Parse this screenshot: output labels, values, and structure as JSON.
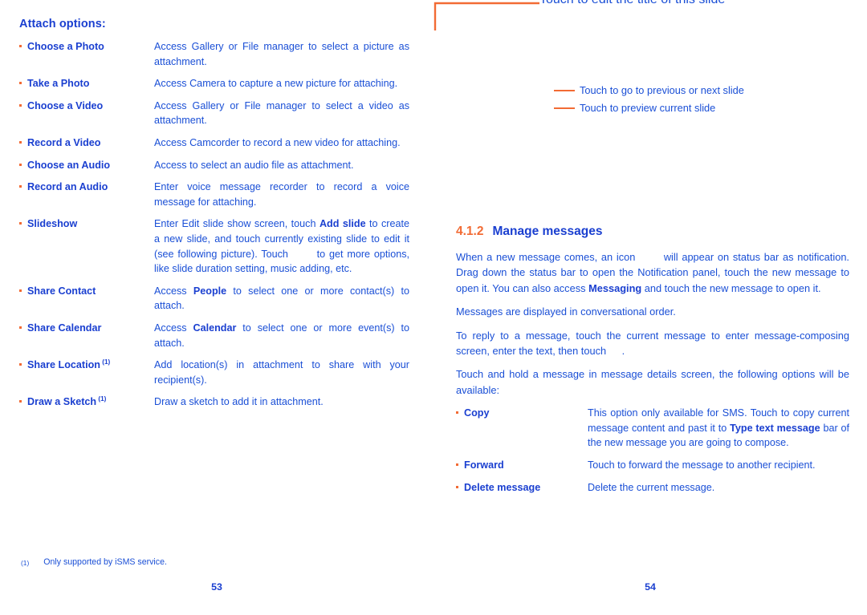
{
  "document": {
    "accent_blue": "#1a3fd0",
    "body_blue": "#1a4fd6",
    "accent_orange": "#f26b34"
  },
  "left_page": {
    "heading": "Attach options:",
    "folio": "53",
    "options": [
      {
        "term": "Choose a Photo",
        "footnote_mark": "",
        "desc_parts": [
          {
            "text": "Access Gallery or File manager to select a picture as attachment.",
            "bold": false
          }
        ]
      },
      {
        "term": "Take a Photo",
        "footnote_mark": "",
        "desc_parts": [
          {
            "text": "Access Camera to capture a new picture for attaching.",
            "bold": false
          }
        ]
      },
      {
        "term": "Choose a Video",
        "footnote_mark": "",
        "desc_parts": [
          {
            "text": "Access Gallery or File manager to select a video as attachment.",
            "bold": false
          }
        ]
      },
      {
        "term": "Record a Video",
        "footnote_mark": "",
        "desc_parts": [
          {
            "text": "Access Camcorder to record a new video for attaching.",
            "bold": false
          }
        ]
      },
      {
        "term": "Choose an Audio",
        "footnote_mark": "",
        "desc_parts": [
          {
            "text": "Access to select an audio file as attachment.",
            "bold": false
          }
        ]
      },
      {
        "term": "Record an Audio",
        "footnote_mark": "",
        "desc_parts": [
          {
            "text": "Enter voice message recorder to record a voice message for attaching.",
            "bold": false
          }
        ]
      },
      {
        "term": "Slideshow",
        "footnote_mark": "",
        "desc_parts": [
          {
            "text": "Enter Edit slide show screen, touch ",
            "bold": false
          },
          {
            "text": "Add slide",
            "bold": true
          },
          {
            "text": " to create a new slide, and touch currently existing slide to edit it (see following picture). Touch ",
            "bold": false
          },
          {
            "text": "icon-placeholder",
            "icon_gap": true
          },
          {
            "text": " to get more options, like slide duration setting, music adding, etc.",
            "bold": false
          }
        ]
      },
      {
        "term": "Share Contact",
        "footnote_mark": "",
        "desc_parts": [
          {
            "text": "Access ",
            "bold": false
          },
          {
            "text": "People",
            "bold": true
          },
          {
            "text": " to select one or more contact(s) to attach.",
            "bold": false
          }
        ]
      },
      {
        "term": "Share Calendar",
        "footnote_mark": "",
        "desc_parts": [
          {
            "text": "Access ",
            "bold": false
          },
          {
            "text": "Calendar",
            "bold": true
          },
          {
            "text": " to select one or more event(s) to attach.",
            "bold": false
          }
        ]
      },
      {
        "term": "Share Location",
        "footnote_mark": "(1)",
        "desc_parts": [
          {
            "text": "Add location(s) in attachment to share with your recipient(s).",
            "bold": false
          }
        ]
      },
      {
        "term": "Draw a Sketch",
        "footnote_mark": "(1)",
        "desc_parts": [
          {
            "text": "Draw a sketch to add it in attachment.",
            "bold": false
          }
        ]
      }
    ],
    "footnote": {
      "mark": "(1)",
      "text": "Only supported by iSMS service."
    }
  },
  "right_page": {
    "folio": "54",
    "callouts": [
      {
        "label": "Touch to go to previous or next slide",
        "leader": "dash"
      },
      {
        "label": "Touch to preview current slide",
        "leader": "dash"
      },
      {
        "label": "Touch to edit the title of this slide",
        "leader": "elbow"
      }
    ],
    "section": {
      "number": "4.1.2",
      "title": "Manage messages"
    },
    "paragraphs": [
      [
        {
          "text": "When a new message comes, an icon ",
          "bold": false
        },
        {
          "text": "icon-placeholder",
          "icon_gap": true
        },
        {
          "text": " will appear on status bar as notification. Drag down the status bar to open the Notification panel, touch the new message to open it. You can also access ",
          "bold": false
        },
        {
          "text": "Messaging",
          "bold": true
        },
        {
          "text": " and touch the new message to open it.",
          "bold": false
        }
      ],
      [
        {
          "text": "Messages are displayed in conversational order.",
          "bold": false
        }
      ],
      [
        {
          "text": "To reply to a message, touch the current message to enter message-composing screen, enter the text, then touch ",
          "bold": false
        },
        {
          "text": "icon-placeholder",
          "icon_gap_sm": true
        },
        {
          "text": ".",
          "bold": false
        }
      ],
      [
        {
          "text": "Touch and hold a message in message details screen, the following options will be available:",
          "bold": false
        }
      ]
    ],
    "options": [
      {
        "term": "Copy",
        "desc_parts": [
          {
            "text": "This option only available for SMS. Touch to copy current message content and past it to ",
            "bold": false
          },
          {
            "text": "Type text message",
            "bold": true
          },
          {
            "text": " bar of the new message you are going to compose.",
            "bold": false
          }
        ]
      },
      {
        "term": "Forward",
        "desc_parts": [
          {
            "text": "Touch to forward the message to another recipient.",
            "bold": false
          }
        ]
      },
      {
        "term": "Delete message",
        "desc_parts": [
          {
            "text": "Delete the current message.",
            "bold": false
          }
        ]
      }
    ]
  }
}
